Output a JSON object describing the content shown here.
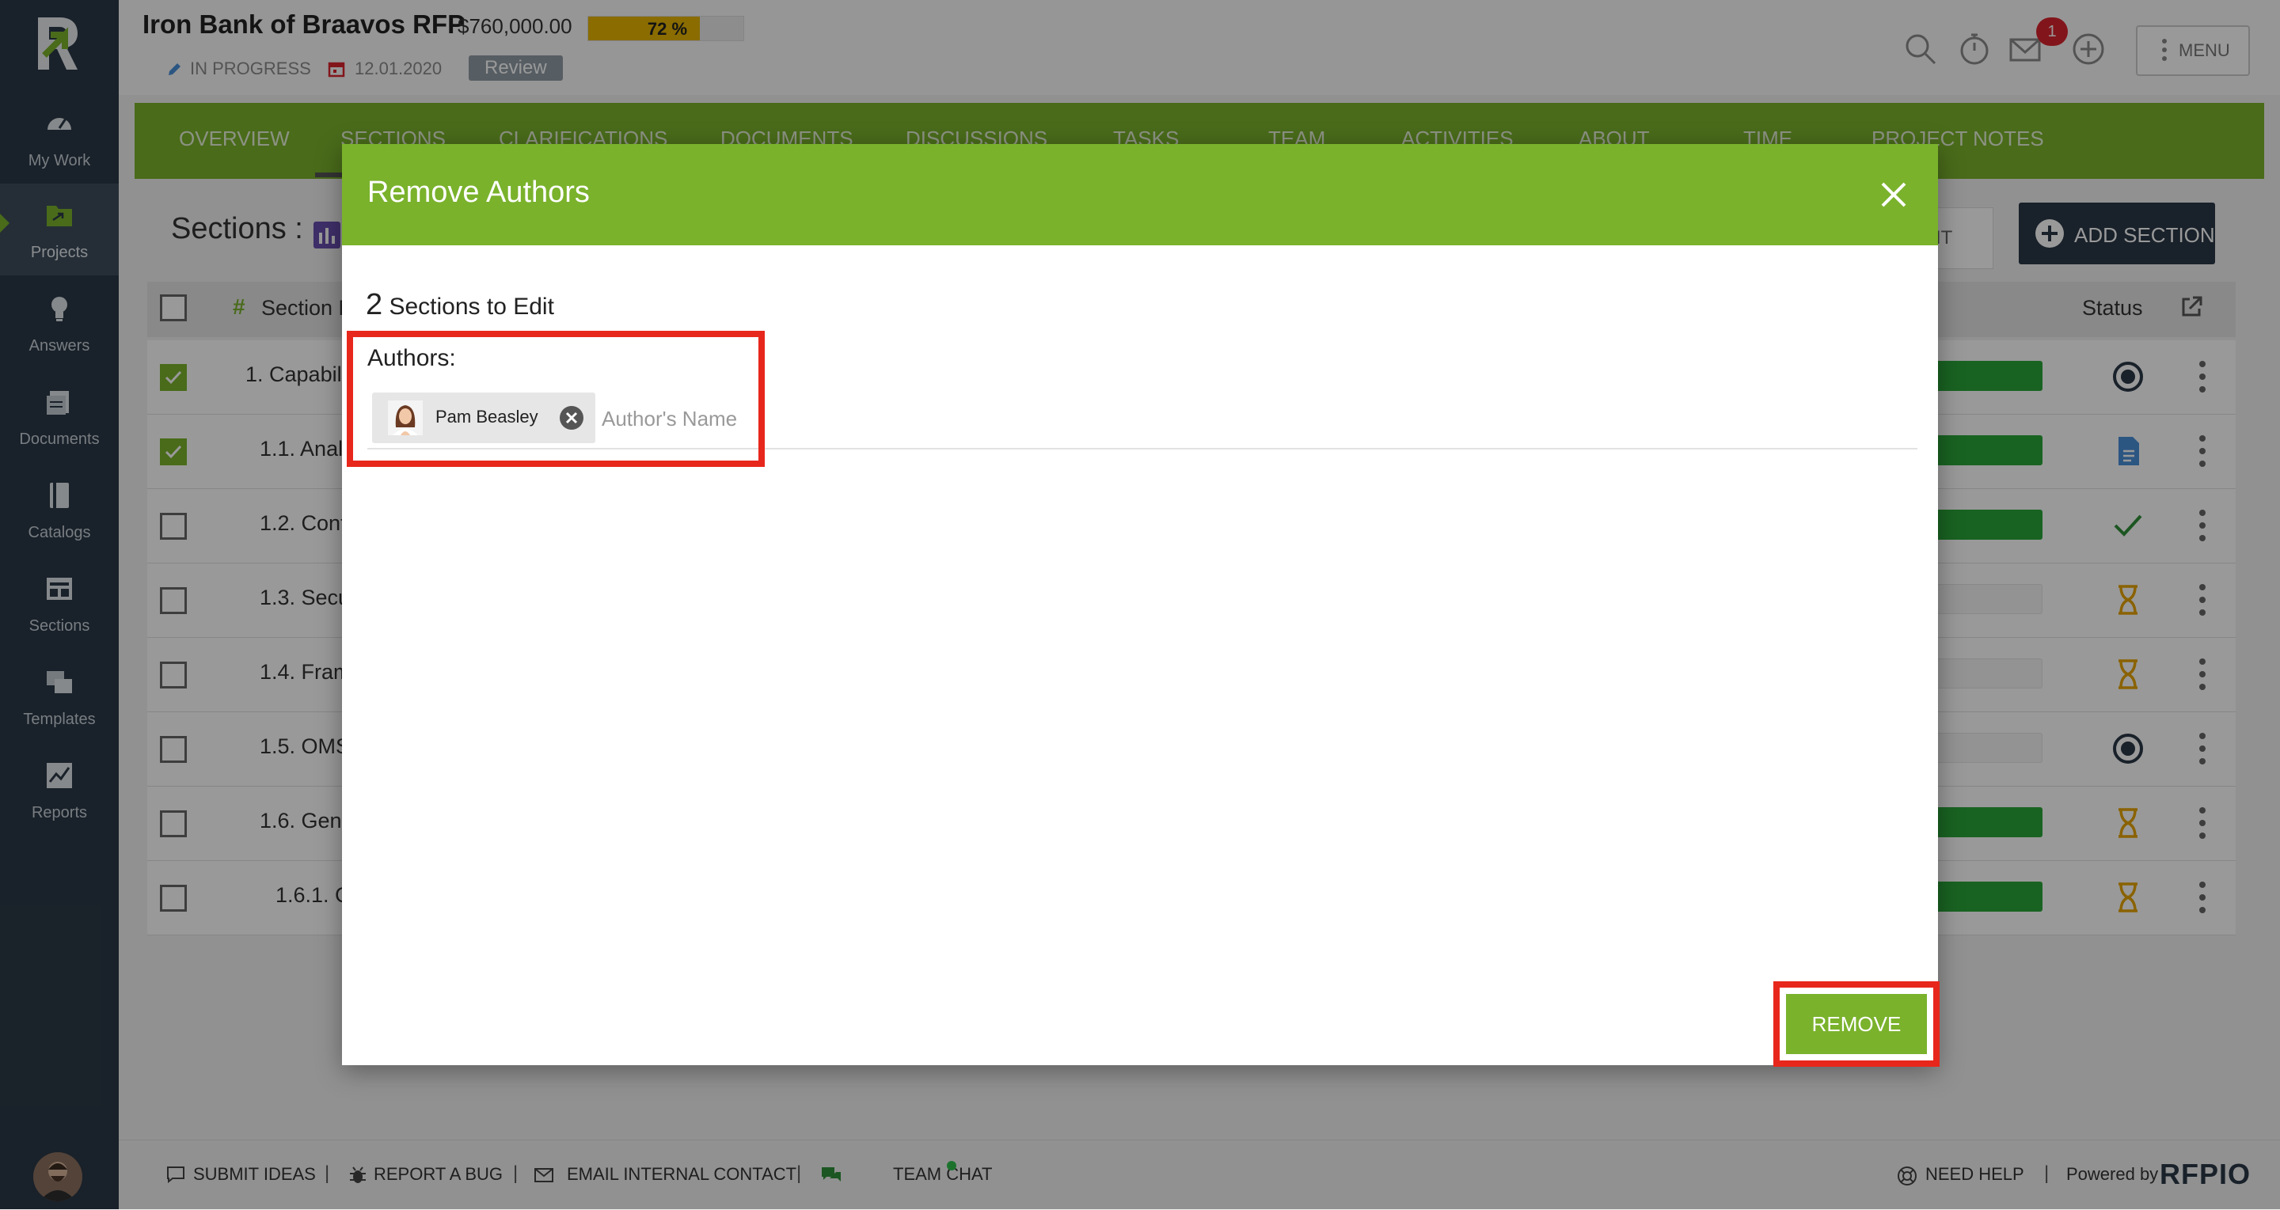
{
  "project": {
    "title": "Iron Bank of Braavos RFP",
    "amount": "$760,000.00",
    "progress_label": "72 %",
    "progress_fraction": 0.72,
    "status": "IN PROGRESS",
    "date": "12.01.2020",
    "stage": "Review"
  },
  "header": {
    "notification_count": "1",
    "menu_label": "MENU"
  },
  "sidebar": {
    "items": [
      {
        "label": "My Work",
        "icon": "speedometer-icon"
      },
      {
        "label": "Projects",
        "icon": "folder-icon"
      },
      {
        "label": "Answers",
        "icon": "lightbulb-icon"
      },
      {
        "label": "Documents",
        "icon": "documents-icon"
      },
      {
        "label": "Catalogs",
        "icon": "book-icon"
      },
      {
        "label": "Sections",
        "icon": "sections-icon"
      },
      {
        "label": "Templates",
        "icon": "templates-icon"
      },
      {
        "label": "Reports",
        "icon": "chart-icon"
      }
    ]
  },
  "tabs": [
    "OVERVIEW",
    "SECTIONS",
    "CLARIFICATIONS",
    "DOCUMENTS",
    "DISCUSSIONS",
    "TASKS",
    "TEAM",
    "ACTIVITIES",
    "ABOUT",
    "TIME",
    "PROJECT NOTES"
  ],
  "page": {
    "sections_title": "Sections :",
    "add_section": "ADD SECTION",
    "edit_label": "IT",
    "col_section": "Section N",
    "col_status": "Status",
    "rows": [
      {
        "label": "1. Capabili",
        "checked": true,
        "bar": "full",
        "status": "target"
      },
      {
        "label": "1.1. Anal",
        "checked": true,
        "bar": "full",
        "status": "doc"
      },
      {
        "label": "1.2. Cont",
        "checked": false,
        "bar": "full",
        "status": "check"
      },
      {
        "label": "1.3. Secu",
        "checked": false,
        "bar": "empty",
        "status": "hourglass"
      },
      {
        "label": "1.4. Fram",
        "checked": false,
        "bar": "empty",
        "status": "hourglass"
      },
      {
        "label": "1.5. OMS",
        "checked": false,
        "bar": "empty",
        "status": "target"
      },
      {
        "label": "1.6. Gene",
        "checked": false,
        "bar": "full",
        "status": "hourglass"
      },
      {
        "label": "1.6.1. C",
        "checked": false,
        "bar": "full",
        "status": "hourglass"
      }
    ]
  },
  "modal": {
    "title": "Remove Authors",
    "count": "2",
    "count_suffix": "Sections to Edit",
    "authors_label": "Authors:",
    "author_chip": "Pam Beasley",
    "author_placeholder": "Author's Name",
    "remove_label": "REMOVE"
  },
  "footer": {
    "submit_ideas": "SUBMIT IDEAS",
    "report_bug": "REPORT A BUG",
    "email_contact": "EMAIL INTERNAL CONTACT",
    "team_chat": "TEAM CHAT",
    "need_help": "NEED HELP",
    "powered_by": "Powered by",
    "brand": "RFPIO",
    "separator": "|"
  },
  "colors": {
    "brand_green": "#7ab22c",
    "sidebar_bg": "#2b3846",
    "progress": "#e6b400",
    "highlight": "#e8271c"
  }
}
